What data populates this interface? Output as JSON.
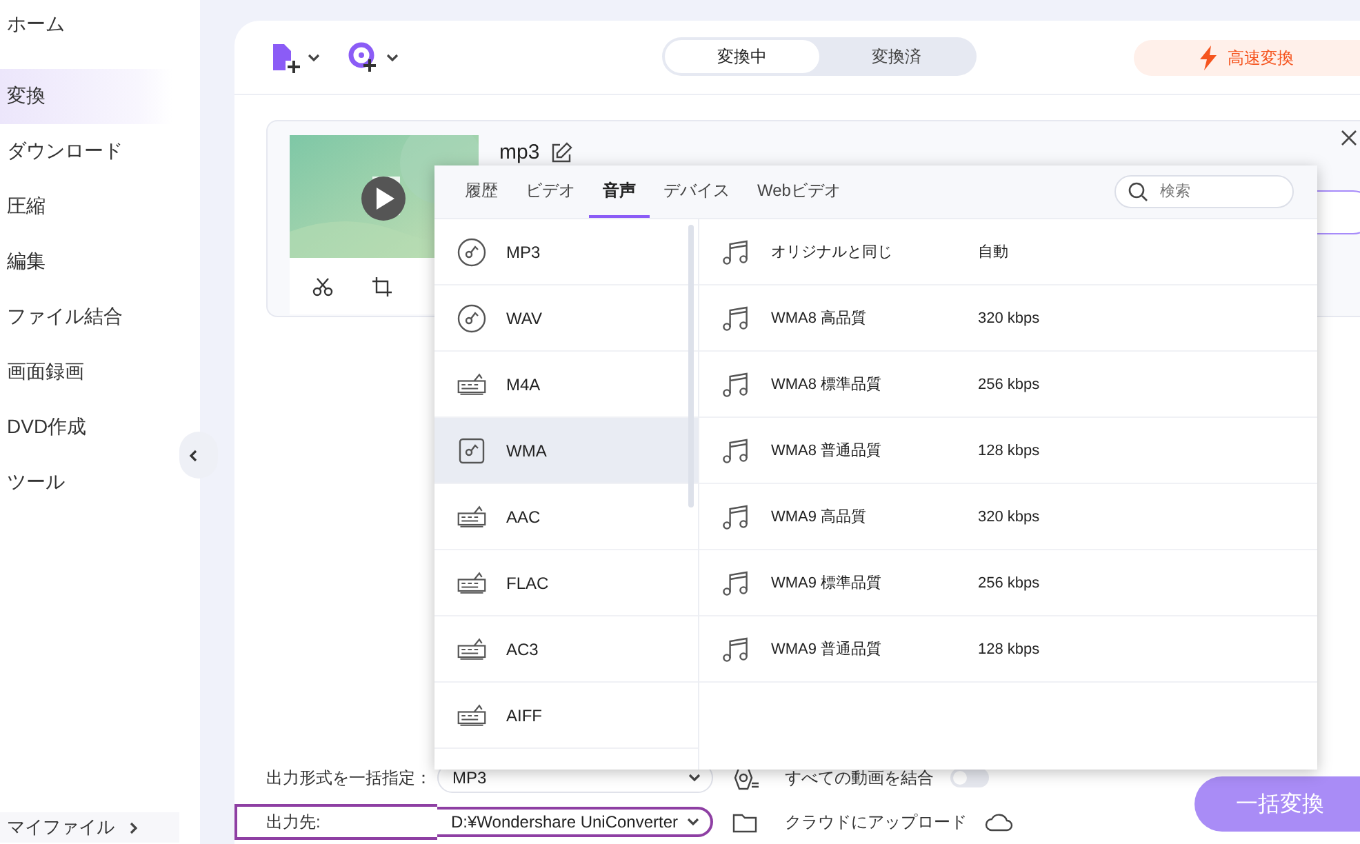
{
  "sidebar": {
    "items": [
      {
        "label": "ホーム",
        "selected": false
      },
      {
        "label": "変換",
        "selected": true
      },
      {
        "label": "ダウンロード",
        "selected": false
      },
      {
        "label": "圧縮",
        "selected": false
      },
      {
        "label": "編集",
        "selected": false
      },
      {
        "label": "ファイル結合",
        "selected": false
      },
      {
        "label": "画面録画",
        "selected": false
      },
      {
        "label": "DVD作成",
        "selected": false
      },
      {
        "label": "ツール",
        "selected": false
      }
    ],
    "footer_item": {
      "label": "マイファイル"
    }
  },
  "toolbar": {
    "status_tabs": [
      {
        "label": "変換中",
        "selected": true
      },
      {
        "label": "変換済",
        "selected": false
      }
    ],
    "fast_convert": "高速変換"
  },
  "file": {
    "title": "mp3"
  },
  "format_popup": {
    "tabs": [
      {
        "label": "履歴",
        "selected": false
      },
      {
        "label": "ビデオ",
        "selected": false
      },
      {
        "label": "音声",
        "selected": true
      },
      {
        "label": "デバイス",
        "selected": false
      },
      {
        "label": "Webビデオ",
        "selected": false
      }
    ],
    "search": {
      "placeholder": "検索"
    },
    "formats": [
      {
        "name": "MP3",
        "kind": "disc",
        "selected": false
      },
      {
        "name": "WAV",
        "kind": "disc",
        "selected": false
      },
      {
        "name": "M4A",
        "kind": "tag",
        "selected": false
      },
      {
        "name": "WMA",
        "kind": "square",
        "selected": true
      },
      {
        "name": "AAC",
        "kind": "tag",
        "selected": false
      },
      {
        "name": "FLAC",
        "kind": "tag",
        "selected": false
      },
      {
        "name": "AC3",
        "kind": "tag",
        "selected": false
      },
      {
        "name": "AIFF",
        "kind": "tag",
        "selected": false
      }
    ],
    "presets": [
      {
        "name": "オリジナルと同じ",
        "bitrate": "自動"
      },
      {
        "name": "WMA8 高品質",
        "bitrate": "320 kbps"
      },
      {
        "name": "WMA8 標準品質",
        "bitrate": "256 kbps"
      },
      {
        "name": "WMA8 普通品質",
        "bitrate": "128 kbps"
      },
      {
        "name": "WMA9 高品質",
        "bitrate": "320 kbps"
      },
      {
        "name": "WMA9 標準品質",
        "bitrate": "256 kbps"
      },
      {
        "name": "WMA9 普通品質",
        "bitrate": "128 kbps"
      }
    ]
  },
  "bottom": {
    "output_format": {
      "label": "出力形式を一括指定：",
      "value": "MP3"
    },
    "merge": {
      "label": "すべての動画を結合",
      "on": false
    },
    "output_path": {
      "label": "出力先:",
      "value": "D:¥Wondershare UniConverter",
      "highlighted": true
    },
    "upload": "クラウドにアップロード",
    "convert_all": "一括変換"
  }
}
